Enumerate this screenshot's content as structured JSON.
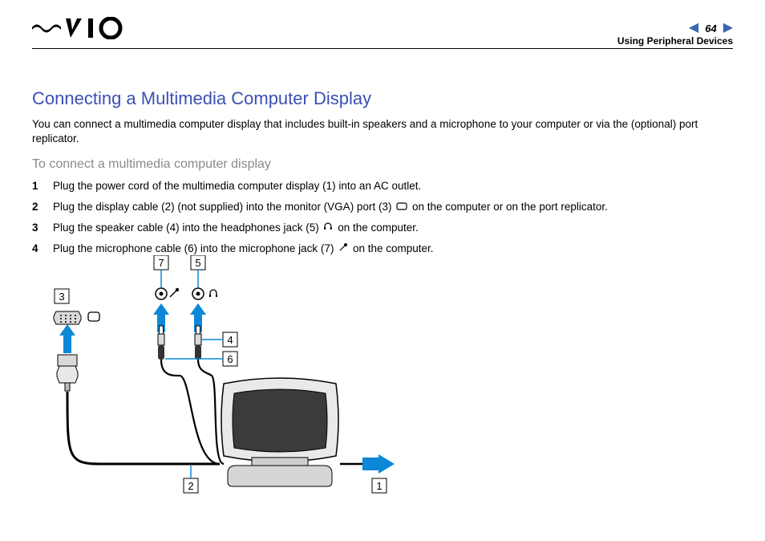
{
  "header": {
    "page_number": "64",
    "section": "Using Peripheral Devices"
  },
  "content": {
    "title": "Connecting a Multimedia Computer Display",
    "intro": "You can connect a multimedia computer display that includes built-in speakers and a microphone to your computer or via the (optional) port replicator.",
    "subtitle": "To connect a multimedia computer display",
    "steps": [
      {
        "n": "1",
        "text": "Plug the power cord of the multimedia computer display (1) into an AC outlet."
      },
      {
        "n": "2",
        "text_before": "Plug the display cable (2) (not supplied) into the monitor (VGA) port (3) ",
        "icon": "monitor-port-icon",
        "text_after": " on the computer or on the port replicator."
      },
      {
        "n": "3",
        "text_before": "Plug the speaker cable (4) into the headphones jack (5) ",
        "icon": "headphones-icon",
        "text_after": " on the computer."
      },
      {
        "n": "4",
        "text_before": "Plug the microphone cable (6) into the microphone jack (7) ",
        "icon": "microphone-icon",
        "text_after": " on the computer."
      }
    ]
  },
  "diagram": {
    "labels": {
      "l1": "1",
      "l2": "2",
      "l3": "3",
      "l4": "4",
      "l5": "5",
      "l6": "6",
      "l7": "7"
    }
  }
}
